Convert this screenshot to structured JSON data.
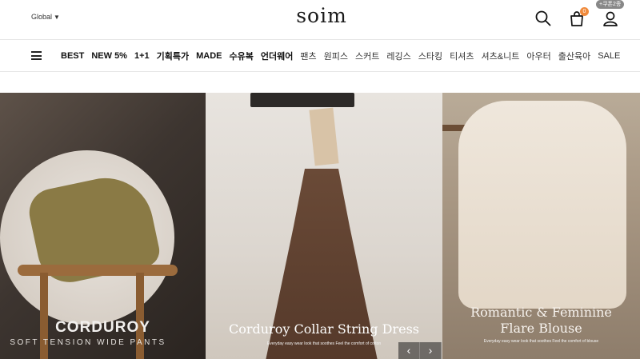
{
  "header": {
    "global_label": "Global",
    "logo": "soim",
    "cart_count": "0",
    "coupon_badge": "+쿠폰2종"
  },
  "nav": {
    "items": [
      {
        "label": "BEST",
        "style": "bold"
      },
      {
        "label": "NEW 5%",
        "style": "bold"
      },
      {
        "label": "1+1",
        "style": "bold"
      },
      {
        "label": "기획특가",
        "style": "bold"
      },
      {
        "label": "MADE",
        "style": "bold"
      },
      {
        "label": "수유복",
        "style": "bold"
      },
      {
        "label": "언더웨어",
        "style": "bold"
      },
      {
        "label": "팬츠",
        "style": "light"
      },
      {
        "label": "원피스",
        "style": "light"
      },
      {
        "label": "스커트",
        "style": "light"
      },
      {
        "label": "레깅스",
        "style": "light"
      },
      {
        "label": "스타킹",
        "style": "light"
      },
      {
        "label": "티셔츠",
        "style": "light"
      },
      {
        "label": "셔츠&니트",
        "style": "light"
      },
      {
        "label": "아우터",
        "style": "light"
      },
      {
        "label": "출산육아",
        "style": "light"
      },
      {
        "label": "SALE",
        "style": "light"
      }
    ]
  },
  "banner": {
    "panel1": {
      "title": "CORDUROY",
      "subtitle": "SOFT TENSION WIDE PANTS"
    },
    "panel2": {
      "title": "Corduroy Collar String Dress",
      "small": "Everyday easy wear look that soothes\nFeel the comfort of cotton"
    },
    "panel3": {
      "title_line1": "Romantic & Feminine",
      "title_line2": "Flare Blouse",
      "small": "Everyday easy wear look that soothes\nFeel the comfort of blouse"
    },
    "prev_arrow": "‹",
    "next_arrow": "›"
  },
  "colors": {
    "accent_badge": "#f08a3c",
    "text": "#111111",
    "border": "#e6e6e6"
  }
}
